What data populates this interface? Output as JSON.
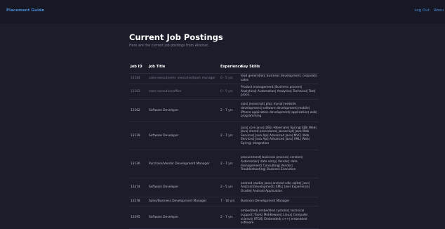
{
  "header": {
    "brand": "Placement Guide",
    "nav": [
      "Log Out",
      "Abou"
    ]
  },
  "page": {
    "title": "Current Job Postings",
    "subtitle": "Here are the current job postings from Aksotec."
  },
  "table": {
    "columns": [
      "Job ID",
      "Job Title",
      "Experience",
      "Key Skills"
    ],
    "rows": [
      {
        "id": "13184",
        "title": "sales executive/sr. executive/team manager",
        "experience": "0 - 5 yrs",
        "skills": "lead generation| business development, corporate sales"
      },
      {
        "id": "13183",
        "title": "sales executive/office",
        "experience": "0 - 5 yrs",
        "skills": "Product management| Business process| Analytical| Automation| Analytics| Technical| Test| proce..."
      },
      {
        "id": "13162",
        "title": "Software Developer",
        "experience": "2 - 7 yrs",
        "skills": "ajax| javascript| php| mysql| website development| software development| mobile| iPhone application development| application| web| programming"
      },
      {
        "id": "13139",
        "title": "Software Developer",
        "experience": "2 - 7 yrs",
        "skills": "java| core java| J2EE| Hibernate| Spring| EJB| Web| Java| stored procedures| javascript| Java Web Services| Java Api| Advanced Java| MVC| Web Services| Java Api| Advanced Java| XML| Web| Spring| integration"
      },
      {
        "id": "13136",
        "title": "Purchase/Vendor Development Manager",
        "experience": "2 - 7 yrs",
        "skills": "procurement| business process| vendors| Automation| data entry| Vendor| data management| Consulting| Vendor| Troubleshooting| Business Execution"
      },
      {
        "id": "13274",
        "title": "Software Developer",
        "experience": "2 - 5 yrs",
        "skills": "android studio| java| android sdk| sqlite| json| Android Development| XML| User Experience| Gradle| Android Application"
      },
      {
        "id": "13278",
        "title": "Sales/Business Development Manager",
        "experience": "7 - 10 yrs",
        "skills": "Business Development Manager"
      },
      {
        "id": "13295",
        "title": "Software Developer",
        "experience": "2 - 7 yrs",
        "skills": "embedded| embedded systems| technical support| Tools| Middleware| Linux| Computer science| RTOS| Embedded| c++| embedded software"
      }
    ]
  }
}
